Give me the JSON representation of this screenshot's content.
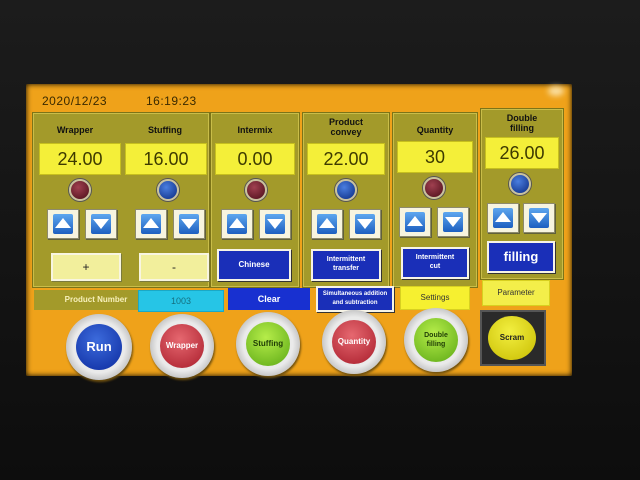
{
  "header": {
    "date": "2020/12/23",
    "time": "16:19:23"
  },
  "panels": {
    "wrapper": {
      "title": "Wrapper",
      "value": "24.00",
      "led": "red"
    },
    "stuffing": {
      "title": "Stuffing",
      "value": "16.00",
      "led": "blue"
    },
    "intermix": {
      "title": "Intermix",
      "value": "0.00",
      "led": "red"
    },
    "convey": {
      "title_line1": "Product",
      "title_line2": "convey",
      "value": "22.00",
      "led": "blue"
    },
    "quantity": {
      "title": "Quantity",
      "value": "30",
      "led": "red"
    },
    "double": {
      "title_line1": "Double",
      "title_line2": "filling",
      "value": "26.00",
      "led": "blue"
    }
  },
  "buttons": {
    "plus": "+",
    "minus": "-",
    "chinese": "Chinese",
    "intermittent_transfer_1": "Intermittent",
    "intermittent_transfer_2": "transfer",
    "intermittent_cut_1": "Intermittent",
    "intermittent_cut_2": "cut",
    "filling": "filling",
    "clear": "Clear",
    "simul_1": "Simultaneous addition",
    "simul_2": "and subtraction",
    "settings": "Settings",
    "parameter": "Parameter"
  },
  "product": {
    "label": "Product Number",
    "value": "1003"
  },
  "actions": {
    "run": "Run",
    "wrapper": "Wrapper",
    "stuffing": "Stuffing",
    "quantity": "Quantity",
    "double_1": "Double",
    "double_2": "filling",
    "scram": "Scram"
  },
  "colors": {
    "screen": "#efa21a",
    "panel": "#a39a2a",
    "value_bg": "#f4ef39",
    "blue_button": "#1830d0"
  }
}
